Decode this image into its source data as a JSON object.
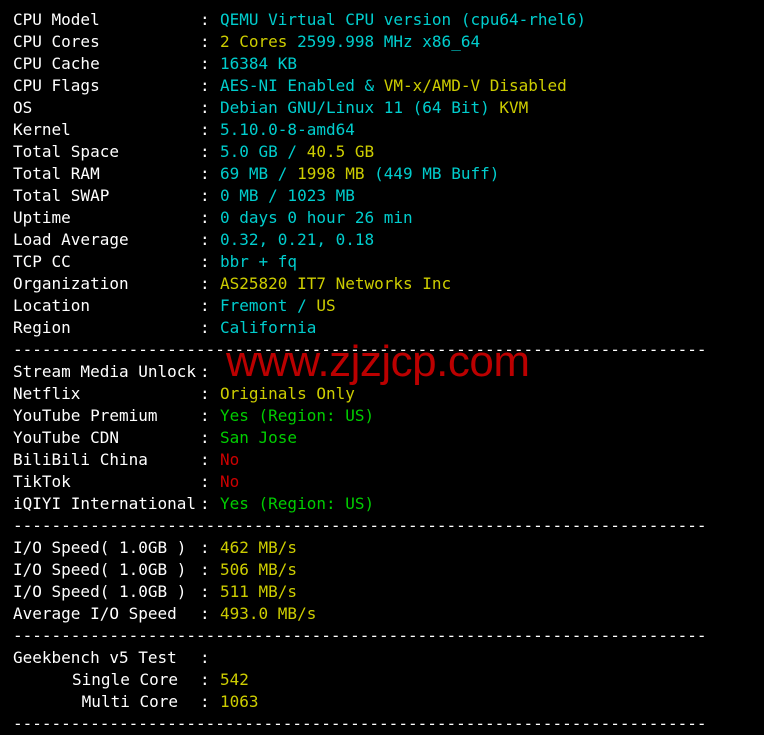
{
  "terminal": {
    "background": "#000000",
    "colors": {
      "label": "#ffffff",
      "cyan": "#00cdcd",
      "yellow": "#cdcd00",
      "green": "#00cd00",
      "red": "#cd0000",
      "watermark": "#bb0000"
    },
    "separator": "------------------------------------------------------------------------",
    "watermark": "www.zjzjcp.com"
  },
  "system": {
    "rows": [
      {
        "label": "CPU Model",
        "colon": ":",
        "parts": [
          {
            "text": "QEMU Virtual CPU version (cpu64-rhel6)",
            "color": "cyan"
          }
        ]
      },
      {
        "label": "CPU Cores",
        "colon": ":",
        "parts": [
          {
            "text": "2 Cores ",
            "color": "yellow"
          },
          {
            "text": "2599.998 MHz x86_64",
            "color": "cyan"
          }
        ]
      },
      {
        "label": "CPU Cache",
        "colon": ":",
        "parts": [
          {
            "text": "16384 KB",
            "color": "cyan"
          }
        ]
      },
      {
        "label": "CPU Flags",
        "colon": ":",
        "parts": [
          {
            "text": "AES-NI Enabled & ",
            "color": "cyan"
          },
          {
            "text": "VM-x/AMD-V Disabled",
            "color": "yellow"
          }
        ]
      },
      {
        "label": "OS",
        "colon": ":",
        "parts": [
          {
            "text": "Debian GNU/Linux 11 (64 Bit) ",
            "color": "cyan"
          },
          {
            "text": "KVM",
            "color": "yellow"
          }
        ]
      },
      {
        "label": "Kernel",
        "colon": ":",
        "parts": [
          {
            "text": "5.10.0-8-amd64",
            "color": "cyan"
          }
        ]
      },
      {
        "label": "Total Space",
        "colon": ":",
        "parts": [
          {
            "text": "5.0 GB / ",
            "color": "cyan"
          },
          {
            "text": "40.5 GB",
            "color": "yellow"
          }
        ]
      },
      {
        "label": "Total RAM",
        "colon": ":",
        "parts": [
          {
            "text": "69 MB / ",
            "color": "cyan"
          },
          {
            "text": "1998 MB ",
            "color": "yellow"
          },
          {
            "text": "(449 MB Buff)",
            "color": "cyan"
          }
        ]
      },
      {
        "label": "Total SWAP",
        "colon": ":",
        "parts": [
          {
            "text": "0 MB / 1023 MB",
            "color": "cyan"
          }
        ]
      },
      {
        "label": "Uptime",
        "colon": ":",
        "parts": [
          {
            "text": "0 days 0 hour 26 min",
            "color": "cyan"
          }
        ]
      },
      {
        "label": "Load Average",
        "colon": ":",
        "parts": [
          {
            "text": "0.32, 0.21, 0.18",
            "color": "cyan"
          }
        ]
      },
      {
        "label": "TCP CC",
        "colon": ":",
        "parts": [
          {
            "text": "bbr + fq",
            "color": "cyan"
          }
        ]
      },
      {
        "label": "Organization",
        "colon": ":",
        "parts": [
          {
            "text": "AS25820 IT7 Networks Inc",
            "color": "yellow"
          }
        ]
      },
      {
        "label": "Location",
        "colon": ":",
        "parts": [
          {
            "text": "Fremont / ",
            "color": "cyan"
          },
          {
            "text": "US",
            "color": "yellow"
          }
        ]
      },
      {
        "label": "Region",
        "colon": ":",
        "parts": [
          {
            "text": "California",
            "color": "cyan"
          }
        ]
      }
    ]
  },
  "stream_media": {
    "rows": [
      {
        "label": "Stream Media Unlock",
        "colon": ":",
        "parts": []
      },
      {
        "label": "Netflix",
        "colon": ":",
        "parts": [
          {
            "text": "Originals Only",
            "color": "yellow"
          }
        ]
      },
      {
        "label": "YouTube Premium",
        "colon": ":",
        "parts": [
          {
            "text": "Yes (Region: US)",
            "color": "green"
          }
        ]
      },
      {
        "label": "YouTube CDN",
        "colon": ":",
        "parts": [
          {
            "text": "San Jose",
            "color": "green"
          }
        ]
      },
      {
        "label": "BiliBili China",
        "colon": ":",
        "parts": [
          {
            "text": "No",
            "color": "red"
          }
        ]
      },
      {
        "label": "TikTok",
        "colon": ":",
        "parts": [
          {
            "text": "No",
            "color": "red"
          }
        ]
      },
      {
        "label": "iQIYI International",
        "colon": ":",
        "parts": [
          {
            "text": "Yes (Region: US)",
            "color": "green"
          }
        ]
      }
    ]
  },
  "io_speed": {
    "rows": [
      {
        "label": "I/O Speed( 1.0GB )",
        "colon": ":",
        "parts": [
          {
            "text": "462 MB/s",
            "color": "yellow"
          }
        ]
      },
      {
        "label": "I/O Speed( 1.0GB )",
        "colon": ":",
        "parts": [
          {
            "text": "506 MB/s",
            "color": "yellow"
          }
        ]
      },
      {
        "label": "I/O Speed( 1.0GB )",
        "colon": ":",
        "parts": [
          {
            "text": "511 MB/s",
            "color": "yellow"
          }
        ]
      },
      {
        "label": "Average I/O Speed",
        "colon": ":",
        "parts": [
          {
            "text": "493.0 MB/s",
            "color": "yellow"
          }
        ]
      }
    ]
  },
  "geekbench": {
    "rows": [
      {
        "label": "Geekbench v5 Test",
        "colon": ":",
        "indent": false,
        "parts": []
      },
      {
        "label": "Single Core",
        "colon": ":",
        "indent": true,
        "parts": [
          {
            "text": "542",
            "color": "yellow"
          }
        ]
      },
      {
        "label": "Multi Core",
        "colon": ":",
        "indent": true,
        "parts": [
          {
            "text": "1063",
            "color": "yellow"
          }
        ]
      }
    ]
  }
}
